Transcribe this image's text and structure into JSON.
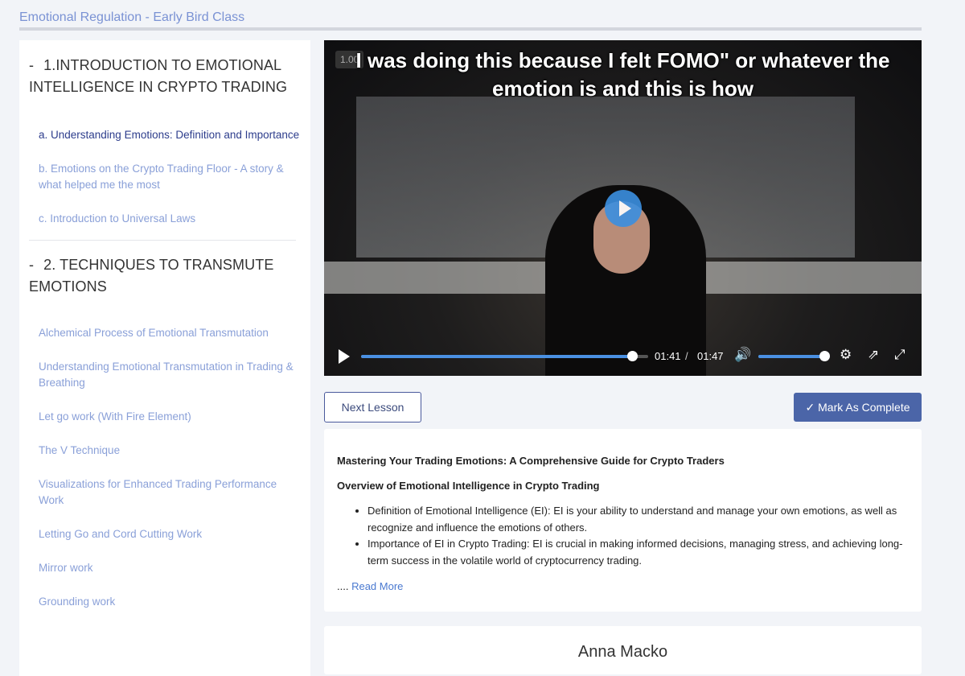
{
  "page": {
    "title": "Emotional Regulation - Early Bird Class"
  },
  "sidebar": {
    "sections": [
      {
        "marker": "-",
        "title": "1.INTRODUCTION TO EMOTIONAL INTELLIGENCE IN CRYPTO TRADING",
        "items": [
          {
            "label": "a. Understanding Emotions: Definition and Importance",
            "active": true
          },
          {
            "label": "b. Emotions on the Crypto Trading Floor - A story & what helped me the most"
          },
          {
            "label": "c. Introduction to Universal Laws"
          }
        ]
      },
      {
        "marker": "-",
        "title": "2. TECHNIQUES TO TRANSMUTE EMOTIONS",
        "items": [
          {
            "label": "Alchemical Process of Emotional Transmutation"
          },
          {
            "label": "Understanding Emotional Transmutation in Trading & Breathing"
          },
          {
            "label": "Let go work (With Fire Element)"
          },
          {
            "label": "The V Technique"
          },
          {
            "label": "Visualizations for Enhanced Trading Performance Work"
          },
          {
            "label": "Letting Go and Cord Cutting Work"
          },
          {
            "label": "Mirror work"
          },
          {
            "label": "Grounding work"
          }
        ]
      }
    ]
  },
  "video": {
    "speed": "1.00",
    "caption": "I was doing this because I felt FOMO\" or whatever the emotion is and this is how",
    "current_time": "01:41",
    "separator": "/",
    "duration": "01:47",
    "progress_percent": 94.4,
    "volume_percent": 100
  },
  "actions": {
    "next_label": "Next Lesson",
    "complete_label": "Mark As Complete"
  },
  "description": {
    "heading": "Mastering Your Trading Emotions: A Comprehensive Guide for Crypto Traders",
    "subheading": "Overview of Emotional Intelligence in Crypto Trading",
    "bullets": [
      "Definition of Emotional Intelligence (EI): EI is your ability to understand and manage your own emotions, as well as recognize and influence the emotions of others.",
      "Importance of EI in Crypto Trading: EI is crucial in making informed decisions, managing stress, and achieving long-term success in the volatile world of cryptocurrency trading."
    ],
    "ellipsis": "....",
    "read_more": "Read More"
  },
  "author": {
    "name": "Anna Macko"
  },
  "colors": {
    "accent": "#4b65a8",
    "link": "#8aa0d8",
    "active": "#2d3d8c",
    "progress": "#4a90e2"
  }
}
